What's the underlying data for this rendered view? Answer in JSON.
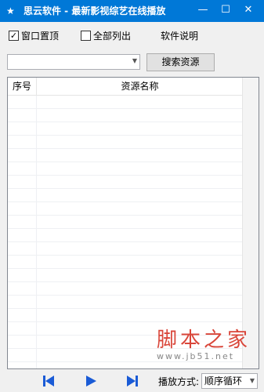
{
  "window": {
    "title": "思云软件 - 最新影视综艺在线播放",
    "icon": "star-icon",
    "controls": [
      "minimize-icon",
      "maximize-icon",
      "close-icon"
    ]
  },
  "options": {
    "window_topmost": {
      "label": "窗口置顶",
      "checked": true
    },
    "list_all": {
      "label": "全部列出",
      "checked": false
    },
    "about_label": "软件说明"
  },
  "search": {
    "combo_value": "",
    "button_label": "搜索资源"
  },
  "list": {
    "columns": [
      "序号",
      "资源名称"
    ],
    "rows": []
  },
  "playback": {
    "prev_icon": "skip-previous-icon",
    "play_icon": "play-icon",
    "next_icon": "skip-next-icon",
    "mode_label": "播放方式:",
    "mode_value": "顺序循环",
    "accent_color": "#1a5bd6"
  },
  "watermark": {
    "main": "脚本之家",
    "sub": "www.jb51.net"
  }
}
